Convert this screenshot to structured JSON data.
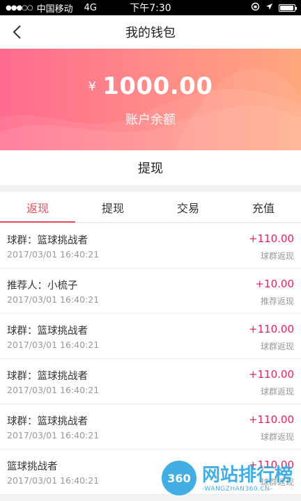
{
  "status_bar": {
    "carrier": "中国移动",
    "network": "4G",
    "time": "下午7:30",
    "battery_level": 0.95
  },
  "nav": {
    "title": "我的钱包",
    "back_icon": "chevron-left-icon"
  },
  "wallet": {
    "currency_symbol": "¥",
    "balance": "1000.00",
    "balance_label": "账户余额"
  },
  "withdraw_label": "提现",
  "tabs": [
    {
      "label": "返现",
      "active": true
    },
    {
      "label": "提现",
      "active": false
    },
    {
      "label": "交易",
      "active": false
    },
    {
      "label": "充值",
      "active": false
    }
  ],
  "transactions": [
    {
      "title": "球群：篮球挑战者",
      "date": "2017/03/01 16:40:21",
      "amount": "+110.00",
      "type": "球群返现"
    },
    {
      "title": "推荐人：小梳子",
      "date": "2017/03/01 16:40:21",
      "amount": "+10.00",
      "type": "推荐返现"
    },
    {
      "title": "球群：篮球挑战者",
      "date": "2017/03/01 16:40:21",
      "amount": "+110.00",
      "type": "球群返现"
    },
    {
      "title": "球群：篮球挑战者",
      "date": "2017/03/01 16:40:21",
      "amount": "+110.00",
      "type": "球群返现"
    },
    {
      "title": "球群：篮球挑战者",
      "date": "2017/03/01 16:40:21",
      "amount": "+110.00",
      "type": "球群返现"
    },
    {
      "title": "篮球挑战者",
      "date": "2017/03/01 16:40:21",
      "amount": "+110.00",
      "type": "球群返现"
    }
  ],
  "watermark": {
    "logo_text": "360",
    "title": "网站排行榜",
    "subtitle": "-WANGZHAN360.CN-"
  },
  "colors": {
    "accent": "#ef4a5a",
    "amount": "#e2245a",
    "hero_start": "#ff6b8f",
    "hero_end": "#ffa77e"
  }
}
